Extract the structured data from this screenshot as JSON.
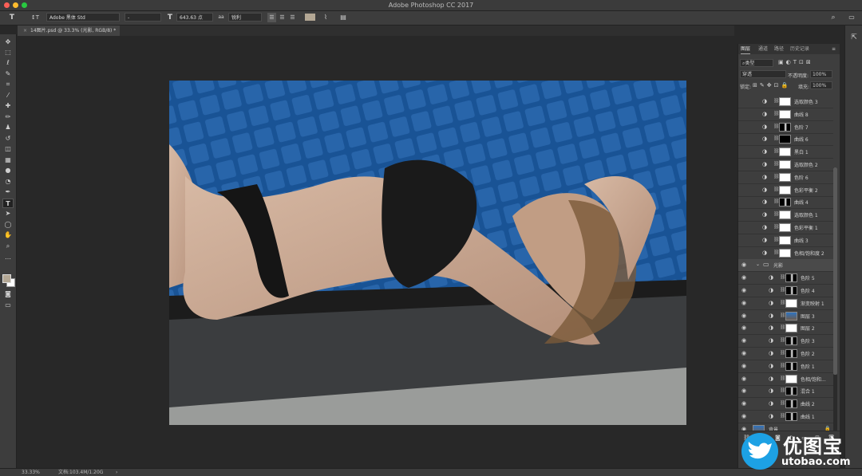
{
  "app_title": "Adobe Photoshop CC 2017",
  "options_bar": {
    "font_family": "Adobe 黑体 Std",
    "font_style": "-",
    "font_size": "643.63 点",
    "aa_label": "aa",
    "aa_mode": "锐利"
  },
  "document_tab": "14图片.psd @ 33.3% (光影, RGB/8) *",
  "panel": {
    "tabs": [
      "图层",
      "通道",
      "路径",
      "历史记录"
    ],
    "filter": "类型",
    "blend_mode": "穿透",
    "opacity_label": "不透明度:",
    "opacity": "100%",
    "lock_label": "锁定:",
    "fill_label": "填充:",
    "fill": "100%",
    "group_name": "光影",
    "layers_top": [
      {
        "name": "选取颜色 3",
        "mask": "white"
      },
      {
        "name": "曲线 8",
        "mask": "white"
      },
      {
        "name": "色阶 7",
        "mask": "dark"
      },
      {
        "name": "曲线 6",
        "mask": "black"
      },
      {
        "name": "黑白 1",
        "mask": "white"
      },
      {
        "name": "选取颜色 2",
        "mask": "white"
      },
      {
        "name": "色阶 6",
        "mask": "white"
      },
      {
        "name": "色彩平衡 2",
        "mask": "white"
      },
      {
        "name": "曲线 4",
        "mask": "dark"
      },
      {
        "name": "选取颜色 1",
        "mask": "white"
      },
      {
        "name": "色彩平衡 1",
        "mask": "white"
      },
      {
        "name": "曲线 3",
        "mask": "white"
      },
      {
        "name": "色相/饱和度 2",
        "mask": "white"
      }
    ],
    "layers_group": [
      {
        "name": "色阶 5",
        "mask": "dark"
      },
      {
        "name": "色阶 4",
        "mask": "dark"
      },
      {
        "name": "渐变映射 1",
        "mask": "white"
      },
      {
        "name": "图层 3",
        "mask": "photo"
      },
      {
        "name": "图层 2",
        "mask": "white"
      },
      {
        "name": "色阶 3",
        "mask": "dark"
      },
      {
        "name": "色阶 2",
        "mask": "dark"
      },
      {
        "name": "色阶 1",
        "mask": "dark"
      },
      {
        "name": "色相/饱和...",
        "mask": "white"
      },
      {
        "name": "混合 1",
        "mask": "dark"
      },
      {
        "name": "曲线 2",
        "mask": "dark"
      },
      {
        "name": "曲线 1",
        "mask": "dark"
      }
    ],
    "background_layer": "背景"
  },
  "status": {
    "zoom": "33.33%",
    "doc_info": "文档:103.4M/1.20G"
  },
  "watermark": {
    "logo_text": "优图宝",
    "url": "utobao.com"
  },
  "colors": {
    "foreground": "#b3a794",
    "background": "#ffffff",
    "pool_blue": "#2a6fb8"
  }
}
